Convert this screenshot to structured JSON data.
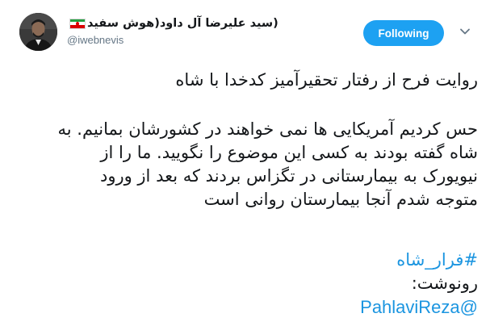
{
  "tweet": {
    "author": {
      "display_name": "سید علیرضا آل داود(هوش سفید",
      "paren_close": ")",
      "handle": "@iwebnevis",
      "flag": "iran-flag"
    },
    "follow_button_label": "Following",
    "menu_icon": "chevron-down-icon",
    "text_lines": [
      "روایت فرح از رفتار تحقیرآمیز کدخدا با شاه",
      "حس کردیم آمریکایی ها نمی خواهند در کشورشان بمانیم. به",
      "شاه گفته بودند به کسی این موضوع را نگویید. ما را از",
      "نیویورک به بیمارستانی در تگزاس بردند که بعد از ورود",
      "متوجه شدم آنجا بیمارستان روانی است"
    ],
    "hashtag": "#فرار_شاه",
    "cc_label": "رونوشت:",
    "mention": "@PahlaviReza",
    "colors": {
      "link": "#1b95e0",
      "button": "#1da1f2",
      "text": "#14171a",
      "muted": "#657786"
    }
  }
}
